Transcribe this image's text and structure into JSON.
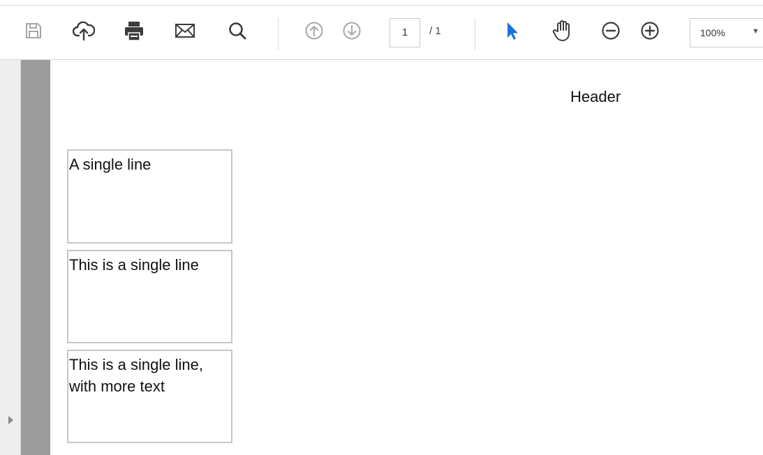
{
  "toolbar": {
    "buttons": {
      "save": "save-icon",
      "upload": "cloud-upload-icon",
      "print": "printer-icon",
      "email": "envelope-icon",
      "search": "magnifier-icon",
      "prev_page": "arrow-up-circle-icon",
      "next_page": "arrow-down-circle-icon",
      "select_tool": "pointer-arrow-icon",
      "hand_tool": "hand-icon",
      "zoom_out": "minus-circle-icon",
      "zoom_in": "plus-circle-icon"
    },
    "current_page": "1",
    "total_pages": "/ 1",
    "zoom": "100%"
  },
  "document": {
    "header": "Header",
    "cells": [
      "A single line",
      "This is a single line",
      "This is a single line, with more text"
    ]
  },
  "colors": {
    "select_tool_accent": "#1a73d9",
    "gutter": "#9c9c9c",
    "cell_border": "#c6c6c6"
  }
}
